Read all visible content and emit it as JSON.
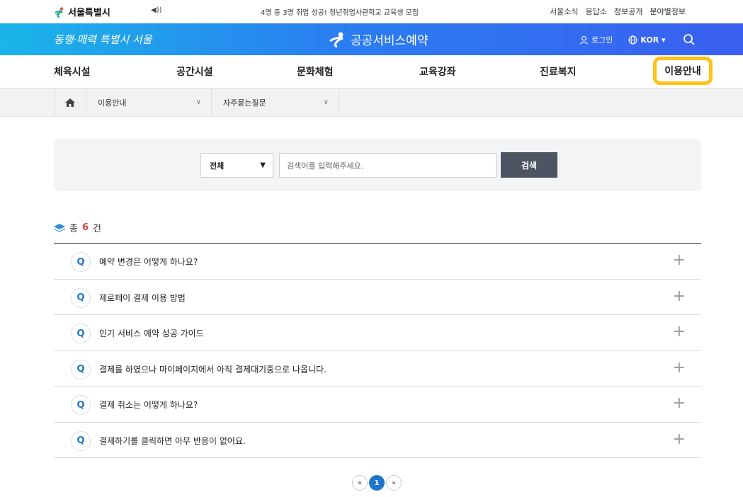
{
  "util": {
    "logo_text": "서울특별시",
    "speaker_icon": "speaker-icon",
    "notice": "4명 중 3명 취업 성공! 청년취업사관학교 교육생 모집",
    "links": [
      "서울소식",
      "응답소",
      "정보공개",
      "분야별정보"
    ]
  },
  "brand": {
    "slogan": "동행·매력 특별시 서울",
    "service_name": "공공서비스예약",
    "login": "로그인",
    "language": "KOR ▾",
    "accent_color": "#2a7ef0"
  },
  "nav": {
    "items": [
      "체육시설",
      "공간시설",
      "문화체험",
      "교육강좌",
      "진료복지",
      "이용안내"
    ],
    "active_index": 5,
    "highlight_color": "#ffc21a"
  },
  "breadcrumb": {
    "level1": "이용안내",
    "level2": "자주묻는질문"
  },
  "search": {
    "category": "전체",
    "placeholder": "검색어를 입력해주세요.",
    "button": "검색"
  },
  "total": {
    "prefix": "총",
    "count": "6",
    "suffix": "건"
  },
  "faq": {
    "q_label": "Q",
    "items": [
      "예약 변경은 어떻게 하나요?",
      "제로페이 결제 이용 방법",
      "인기 서비스 예약 성공 가이드",
      "결제를 하였으나 마이페이지에서 아직 결제대기중으로 나옵니다.",
      "결제 취소는 어떻게 하나요?",
      "결제하기를 클릭하면 아무 반응이 없어요."
    ]
  },
  "pager": {
    "prev": "«",
    "current": "1",
    "next": "»"
  }
}
